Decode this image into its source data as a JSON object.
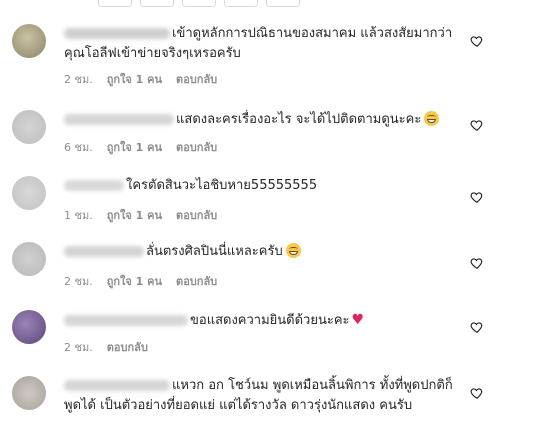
{
  "colors": {
    "accent": "#262626",
    "meta": "#8e8e8e",
    "emoji_heart": "#e0245e"
  },
  "comments": [
    {
      "text": "เข้าดูหลักการปณิธานของสมาคม แล้วสงสัยมากว่า คุณโอลีฟเข้าข่ายจริงๆเหรอครับ",
      "time": "2 ชม.",
      "likes": "ถูกใจ 1 คน",
      "reply": "ตอบกลับ",
      "emoji": ""
    },
    {
      "text": "แสดงละครเรื่องอะไร จะได้ไปติดตามดูนะคะ",
      "time": "6 ชม.",
      "likes": "ถูกใจ 1 คน",
      "reply": "ตอบกลับ",
      "emoji": "grinning-sweat-emoji"
    },
    {
      "text": "ใครตัดสินวะไอชิบหาย55555555",
      "time": "1 ชม.",
      "likes": "ถูกใจ 1 คน",
      "reply": "ตอบกลับ",
      "emoji": ""
    },
    {
      "text": "ลั่นตรงศิลปินนี่แหละครับ",
      "time": "2 ชม.",
      "likes": "ถูกใจ 1 คน",
      "reply": "ตอบกลับ",
      "emoji": "laughing-emoji"
    },
    {
      "text": "ขอแสดงความยินดีด้วยนะคะ",
      "time": "2 ชม.",
      "likes": "",
      "reply": "ตอบกลับ",
      "emoji": "red-heart-emoji"
    },
    {
      "text": "แหวก อก โชว์นม พูดเหมือนลิ้นพิการ ทั้งที่พูดปกติก็พูดได้ เป็นตัวอย่างที่ยอดแย่ แต่ได้รางวัล ดาวรุ่งนักแสดง คนรับ",
      "time": "",
      "likes": "",
      "reply": "",
      "emoji": ""
    }
  ]
}
